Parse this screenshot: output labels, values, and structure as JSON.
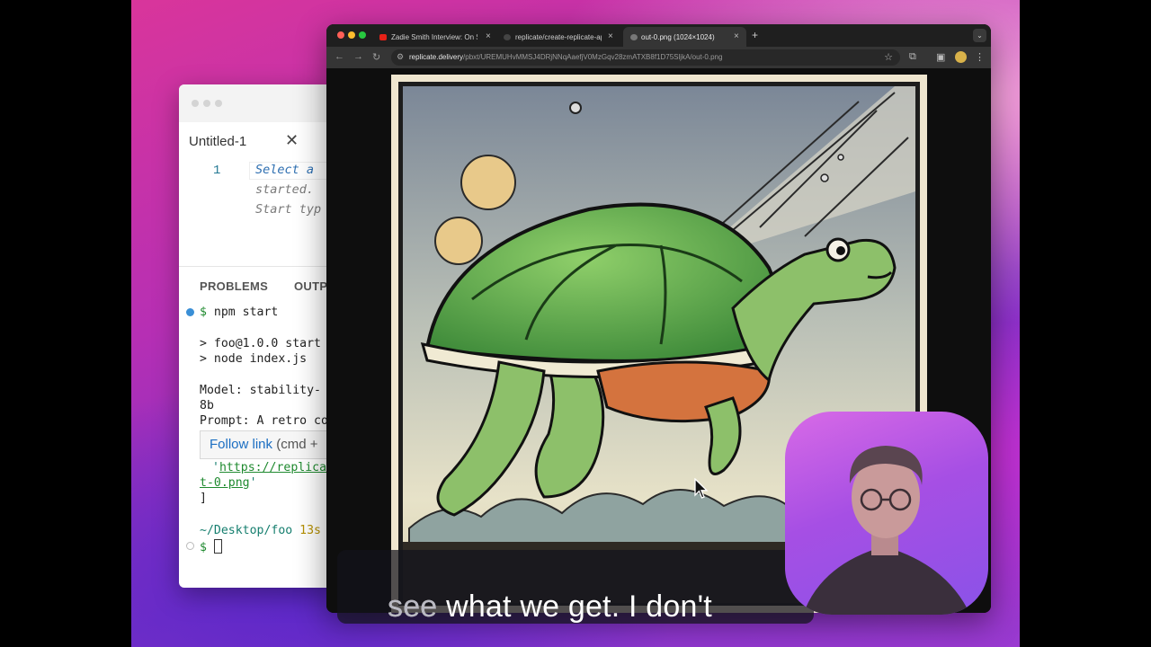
{
  "editor": {
    "tab_title": "Untitled-1",
    "close_glyph": "✕",
    "line_number": "1",
    "hint_lines": [
      "Select a",
      "started.",
      "Start typ"
    ],
    "panel_tabs": [
      "PROBLEMS",
      "OUTP"
    ],
    "terminal": {
      "prompt_symbol": "$",
      "command": "npm start",
      "lines": [
        "> foo@1.0.0 start",
        "> node index.js",
        "Model: stability-",
        "8b",
        "Prompt: A retro co"
      ],
      "tooltip_link": "Follow link",
      "tooltip_hint": " (cmd +",
      "url_quote": "'",
      "url_part1": "https://replica",
      "url_part2": "t-0.png",
      "url_end": "'",
      "bracket": "]",
      "cwd": "~/Desktop/foo",
      "timing": "13s"
    }
  },
  "browser": {
    "tabs": [
      {
        "title": "Zadie Smith Interview: On Sh",
        "icon": "youtube-icon"
      },
      {
        "title": "replicate/create-replicate-ap",
        "icon": "github-icon"
      },
      {
        "title": "out-0.png (1024×1024)",
        "icon": "globe-icon"
      }
    ],
    "url_host": "replicate.delivery",
    "url_path": "/pbxt/UREMUHvMMSJ4DRjNNqAaefjV0MzGqv28zmATXB8f1D75SljkA/out-0.png"
  },
  "caption": {
    "text": "see what we get. I don't ",
    "dim_text": "see"
  },
  "colors": {
    "accent_link": "#1b6ec2",
    "terminal_green": "#1f8a2f",
    "traffic_red": "#ff5f57",
    "traffic_yellow": "#febc2e",
    "traffic_green": "#28c840"
  }
}
